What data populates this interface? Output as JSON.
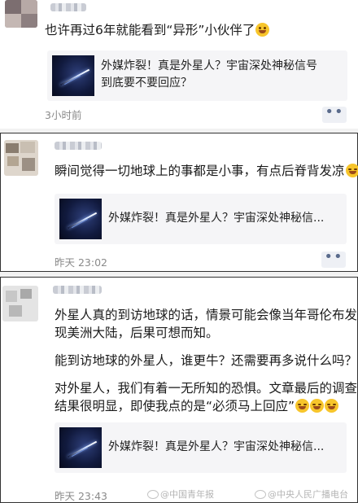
{
  "posts": [
    {
      "text_lines": [
        "也许再过6年就能看到“异形”小伙伴了"
      ],
      "emoji_names": [
        "grin-tongue-emoji"
      ],
      "card_title_lines": [
        "外媒炸裂！真是外星人？宇宙深处神秘信号",
        "到底要不要回应？"
      ],
      "time": "3小时前",
      "more_label": "••"
    },
    {
      "text_lines": [
        "瞬间觉得一切地球上的事都是小事，有点后脊背发凉"
      ],
      "emoji_names": [
        "crying-laugh-emoji"
      ],
      "card_title_lines": [
        "外媒炸裂！真是外星人？宇宙深处神秘信..."
      ],
      "time": "昨天 23:02",
      "more_label": "••"
    },
    {
      "text_lines": [
        "外星人真的到访地球的话，情景可能会像当年哥伦布发",
        "现美洲大陆，后果可想而知。",
        "能到访地球的外星人，谁更牛？还需要再多说什么吗？",
        "对外星人，我们有着一无所知的恐惧。文章最后的调查",
        "结果很明显，即使我点的是“必须马上回应”"
      ],
      "emoji_names": [
        "crying-laugh-emoji",
        "crying-laugh-emoji",
        "crying-laugh-emoji"
      ],
      "card_title_lines": [
        "外媒炸裂！真是外星人？宇宙深处神秘信..."
      ],
      "time": "昨天 23:43",
      "more_label": "••"
    }
  ],
  "watermarks": [
    "@中国青年报",
    "@中央人民广播电台"
  ],
  "colors": {
    "emoji": "#f7c52b",
    "card_bg": "#f5f5f7",
    "time": "#8a8a8a",
    "more_btn_bg": "#eef0f5"
  }
}
